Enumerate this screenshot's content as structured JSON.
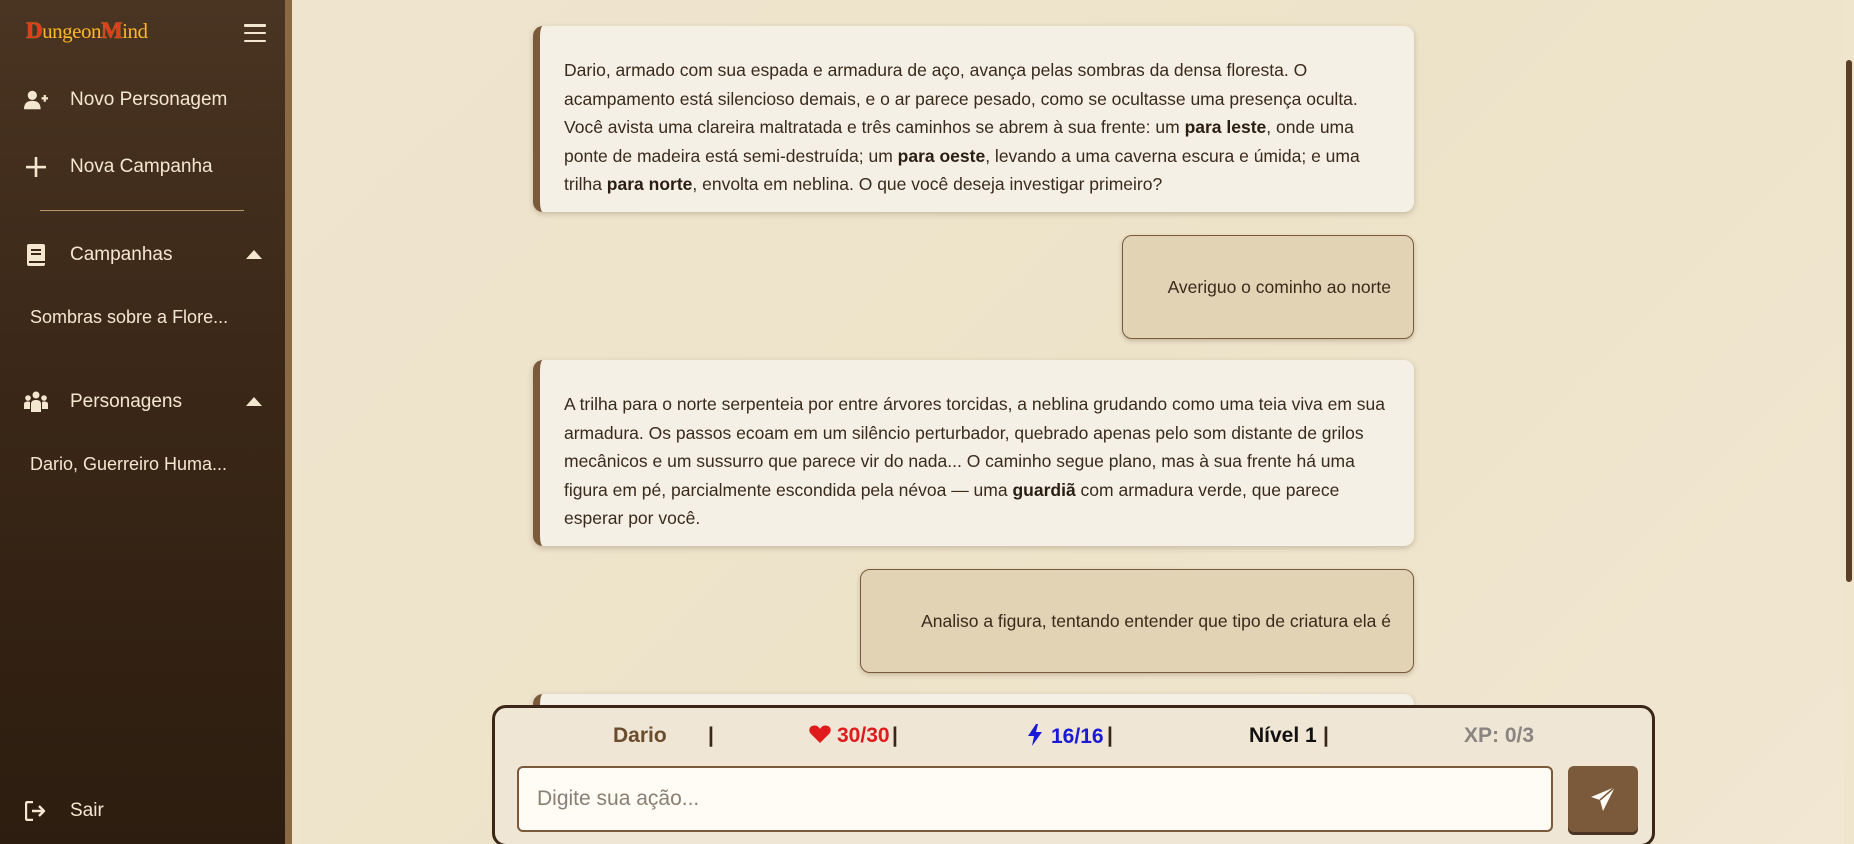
{
  "app": {
    "logo_first_initial": "D",
    "logo_first_rest": "ungeon",
    "logo_second_initial": "M",
    "logo_second_rest": "ind"
  },
  "sidebar": {
    "new_character": "Novo Personagem",
    "new_campaign": "Nova Campanha",
    "campaigns_header": "Campanhas",
    "campaigns": [
      "Sombras sobre a Flore..."
    ],
    "characters_header": "Personagens",
    "characters": [
      "Dario, Guerreiro Huma..."
    ],
    "logout": "Sair"
  },
  "chat": {
    "messages": [
      {
        "role": "narrator",
        "parts": [
          "Dario, armado com sua espada e armadura de aço, avança pelas sombras da densa floresta. O acampamento está silencioso demais, e o ar parece pesado, como se ocultasse uma presença oculta. Você avista uma clareira maltratada e três caminhos se abrem à sua frente: um ",
          "para leste",
          ", onde uma ponte de madeira está semi-destruída; um ",
          "para oeste",
          ", levando a uma caverna escura e úmida; e uma trilha ",
          "para norte",
          ", envolta em neblina. O que você deseja investigar primeiro?"
        ]
      },
      {
        "role": "player",
        "text": "Averiguo o cominho ao norte"
      },
      {
        "role": "narrator",
        "parts": [
          "A trilha para o norte serpenteia por entre árvores torcidas, a neblina grudando como uma teia viva em sua armadura. Os passos ecoam em um silêncio perturbador, quebrado apenas pelo som distante de grilos mecânicos e um sussurro que parece vir do nada... O caminho segue plano, mas à sua frente há uma figura em pé, parcialmente escondida pela névoa — uma ",
          "guardiã",
          " com armadura verde, que parece esperar por você."
        ]
      },
      {
        "role": "player",
        "text": "Analiso a figura, tentando entender que tipo de criatura ela é"
      }
    ]
  },
  "status": {
    "name": "Dario",
    "hp": "30/30",
    "energy": "16/16",
    "level": "Nível 1",
    "xp": "XP: 0/3",
    "separator": "|",
    "colors": {
      "name": "#6b4c2f",
      "hp": "#e01b1b",
      "energy": "#1a1ad6",
      "level": "#111111",
      "xp": "#8a8580"
    }
  },
  "composer": {
    "placeholder": "Digite sua ação...",
    "value": ""
  }
}
